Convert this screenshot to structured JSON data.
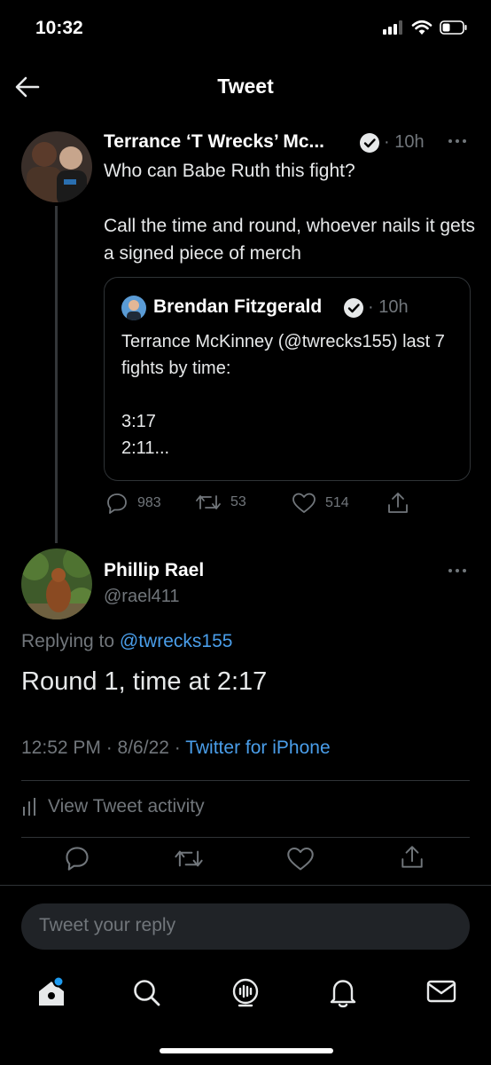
{
  "status_bar": {
    "time": "10:32"
  },
  "nav": {
    "title": "Tweet"
  },
  "original_tweet": {
    "name": "Terrance ‘T Wrecks’ Mc...",
    "time": "· 10h",
    "text": "Who can Babe Ruth this fight?\n\nCall the time and round, whoever nails it gets a signed piece of merch",
    "quote": {
      "name": "Brendan Fitzgerald",
      "time": "· 10h",
      "text": "Terrance McKinney (@twrecks155) last 7 fights by time:\n\n3:17\n2:11..."
    },
    "actions": {
      "replies": "983",
      "retweets": "53",
      "likes": "514"
    }
  },
  "reply_tweet": {
    "name": "Phillip Rael",
    "handle": "@rael411",
    "replying_prefix": "Replying to ",
    "replying_to": "@twrecks155",
    "text": "Round 1, time at 2:17",
    "timestamp": "12:52 PM · 8/6/22 · ",
    "source": "Twitter for iPhone",
    "activity_label": "View Tweet activity"
  },
  "reply_input": {
    "placeholder": "Tweet your reply"
  },
  "colors": {
    "background": "#000000",
    "accent": "#1d9bf0",
    "link": "#4a9eea",
    "muted": "#71767b"
  }
}
